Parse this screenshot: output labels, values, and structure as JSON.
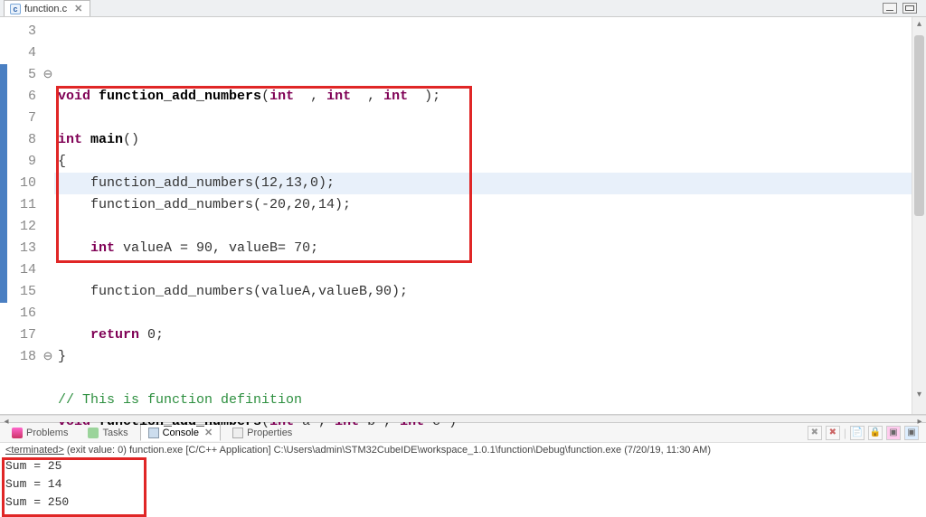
{
  "tab": {
    "filename": "function.c"
  },
  "code": {
    "lines": [
      {
        "n": 3,
        "fold": "",
        "html": "<span class='kw'>void</span> <span class='fn'>function_add_numbers</span>(<span class='kw'>int</span>  , <span class='kw'>int</span>  , <span class='kw'>int</span>  );"
      },
      {
        "n": 4,
        "fold": "",
        "html": ""
      },
      {
        "n": 5,
        "fold": "⊖",
        "html": "<span class='kw'>int</span> <span class='fn'>main</span>()"
      },
      {
        "n": 6,
        "fold": "",
        "html": "{"
      },
      {
        "n": 7,
        "fold": "",
        "hl": true,
        "html": "    function_add_numbers(12,13,0);"
      },
      {
        "n": 8,
        "fold": "",
        "html": "    function_add_numbers(-20,20,14);"
      },
      {
        "n": 9,
        "fold": "",
        "html": ""
      },
      {
        "n": 10,
        "fold": "",
        "html": "    <span class='kw'>int</span> valueA = 90, valueB= 70;"
      },
      {
        "n": 11,
        "fold": "",
        "html": ""
      },
      {
        "n": 12,
        "fold": "",
        "html": "    function_add_numbers(valueA,valueB,90);"
      },
      {
        "n": 13,
        "fold": "",
        "html": ""
      },
      {
        "n": 14,
        "fold": "",
        "html": "    <span class='kw'>return</span> 0;"
      },
      {
        "n": 15,
        "fold": "",
        "html": "}"
      },
      {
        "n": 16,
        "fold": "",
        "html": ""
      },
      {
        "n": 17,
        "fold": "",
        "html": "<span class='cmt'>// This is function definition</span>"
      },
      {
        "n": 18,
        "fold": "⊖",
        "html": "<span class='kw'>void</span> <span class='fn'>function_add_numbers</span>(<span class='kw'>int</span> a , <span class='kw'>int</span> b , <span class='kw'>int</span> c )"
      }
    ]
  },
  "bottomTabs": {
    "problems": "Problems",
    "tasks": "Tasks",
    "console": "Console",
    "properties": "Properties"
  },
  "terminated": "<terminated> (exit value: 0) function.exe [C/C++ Application] C:\\Users\\admin\\STM32CubeIDE\\workspace_1.0.1\\function\\Debug\\function.exe (7/20/19, 11:30 AM)",
  "output": [
    "Sum = 25",
    "Sum = 14",
    "Sum = 250"
  ]
}
